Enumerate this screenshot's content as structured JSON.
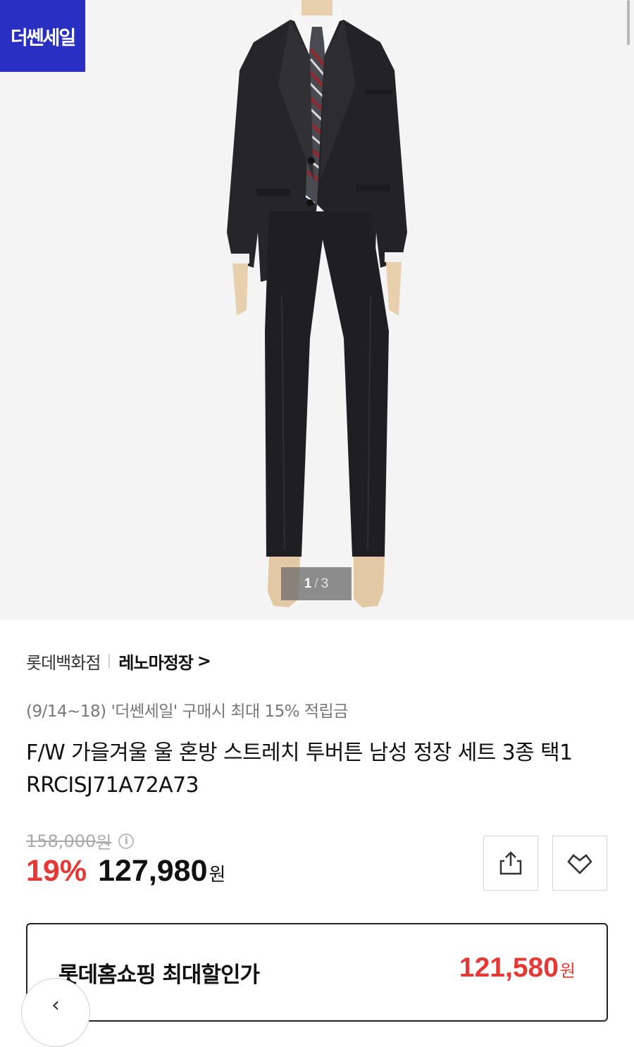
{
  "hero": {
    "badge_text": "더쎈세일",
    "pager": {
      "current": "1",
      "separator": "/",
      "total": "3"
    }
  },
  "seller": {
    "store": "롯데백화점",
    "brand": "레노마정장",
    "brand_chevron": ">"
  },
  "promo_text": "(9/14~18) '더쎈세일' 구매시 최대 15% 적립금",
  "product_title": "F/W 가을겨울 울 혼방 스트레치 투버튼 남성 정장 세트 3종 택1 RRCISJ71A72A73",
  "price": {
    "original": "158,000",
    "original_unit": "원",
    "discount_pct": "19%",
    "sale": "127,980",
    "sale_unit": "원",
    "info_glyph": "i"
  },
  "best_price": {
    "label": "롯데홈쇼핑 최대할인가",
    "value": "121,580",
    "unit": "원"
  },
  "back_glyph": "‹",
  "colors": {
    "badge_bg": "#2a2fc4",
    "accent_red": "#e53935",
    "image_bg": "#f4f4f4"
  },
  "icons": [
    "share-icon",
    "heart-icon",
    "info-icon",
    "chevron-right-icon",
    "back-icon"
  ]
}
